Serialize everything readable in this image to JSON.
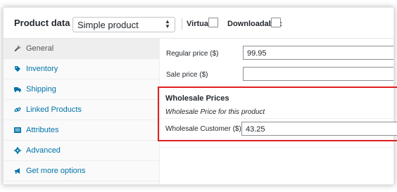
{
  "header": {
    "title": "Product data —",
    "product_type": "Simple product",
    "virtual_label": "Virtual:",
    "downloadable_label": "Downloadable:"
  },
  "sidebar": {
    "items": [
      {
        "label": "General",
        "icon": "wrench-icon",
        "active": true
      },
      {
        "label": "Inventory",
        "icon": "tag-icon",
        "active": false
      },
      {
        "label": "Shipping",
        "icon": "truck-icon",
        "active": false
      },
      {
        "label": "Linked Products",
        "icon": "link-icon",
        "active": false
      },
      {
        "label": "Attributes",
        "icon": "list-icon",
        "active": false
      },
      {
        "label": "Advanced",
        "icon": "gear-icon",
        "active": false
      },
      {
        "label": "Get more options",
        "icon": "megaphone-icon",
        "active": false
      }
    ]
  },
  "general": {
    "regular_price_label": "Regular price ($)",
    "regular_price_value": "99.95",
    "sale_price_label": "Sale price ($)",
    "sale_price_value": ""
  },
  "wholesale": {
    "title": "Wholesale Prices",
    "subtitle": "Wholesale Price for this product",
    "customer_label": "Wholesale Customer ($)",
    "customer_value": "43.25"
  },
  "colors": {
    "link": "#0073aa",
    "highlight_border": "#e21e1e"
  }
}
